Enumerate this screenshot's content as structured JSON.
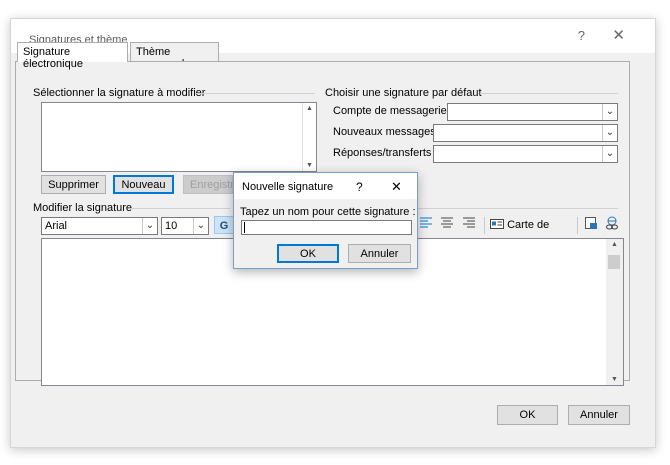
{
  "window": {
    "title": "Signatures et thème",
    "help_label": "?",
    "close_label": "✕"
  },
  "tabs": [
    {
      "label": "Signature électronique",
      "active": true
    },
    {
      "label": "Thème personnel",
      "active": false
    }
  ],
  "select_signature": {
    "group_label": "Sélectionner la signature à modifier",
    "delete_label": "Supprimer",
    "new_label": "Nouveau",
    "save_label": "Enregistrer"
  },
  "default_signature": {
    "group_label": "Choisir une signature par défaut",
    "account_label": "Compte de messagerie :",
    "new_messages_label": "Nouveaux messages :",
    "replies_label": "Réponses/transferts :",
    "account_value": "",
    "new_messages_value": "",
    "replies_value": ""
  },
  "edit_signature": {
    "group_label": "Modifier la signature",
    "font_value": "Arial",
    "size_value": "10",
    "bold_label": "G",
    "business_card_label": "Carte de visite"
  },
  "footer": {
    "ok_label": "OK",
    "cancel_label": "Annuler"
  },
  "new_signature_dialog": {
    "title": "Nouvelle signature",
    "help_label": "?",
    "close_label": "✕",
    "prompt": "Tapez un nom pour cette signature :",
    "input_value": "",
    "ok_label": "OK",
    "cancel_label": "Annuler"
  },
  "colors": {
    "accent": "#0078d7",
    "window_bg": "#f0f0f0"
  }
}
